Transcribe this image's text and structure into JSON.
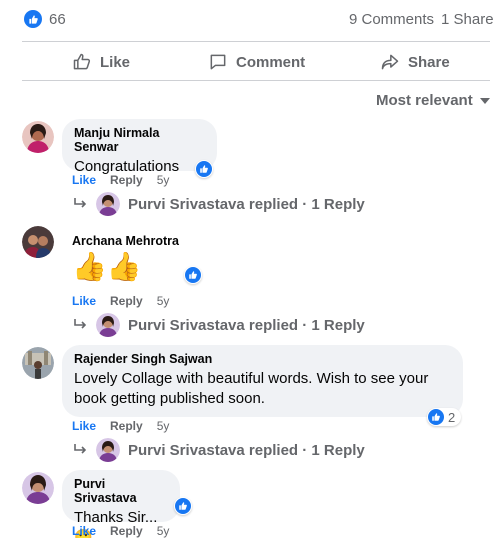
{
  "post": {
    "reaction_count": "66",
    "comments_count": "9 Comments",
    "shares_count": "1 Share"
  },
  "actions": {
    "like": "Like",
    "comment": "Comment",
    "share": "Share"
  },
  "sort": {
    "label": "Most relevant"
  },
  "comments": [
    {
      "author": "Manju Nirmala Senwar",
      "text": "Congratulations",
      "like": "Like",
      "reply": "Reply",
      "time": "5y",
      "replies_label": "Purvi Srivastava replied · 1 Reply"
    },
    {
      "author": "Archana Mehrotra",
      "text": "👍👍",
      "like": "Like",
      "reply": "Reply",
      "time": "5y",
      "replies_label": "Purvi Srivastava replied · 1 Reply"
    },
    {
      "author": "Rajender Singh Sajwan",
      "text": "Lovely Collage with beautiful words. Wish to see your book getting published soon.",
      "like": "Like",
      "reply": "Reply",
      "time": "5y",
      "reaction_count": "2",
      "replies_label": "Purvi Srivastava replied · 1 Reply"
    },
    {
      "author": "Purvi Srivastava",
      "text": "Thanks Sir... 🙂",
      "like": "Like",
      "reply": "Reply",
      "time": "5y"
    }
  ],
  "colors": {
    "accent": "#1877f2",
    "muted": "#65676b",
    "bubble": "#f0f2f5"
  }
}
